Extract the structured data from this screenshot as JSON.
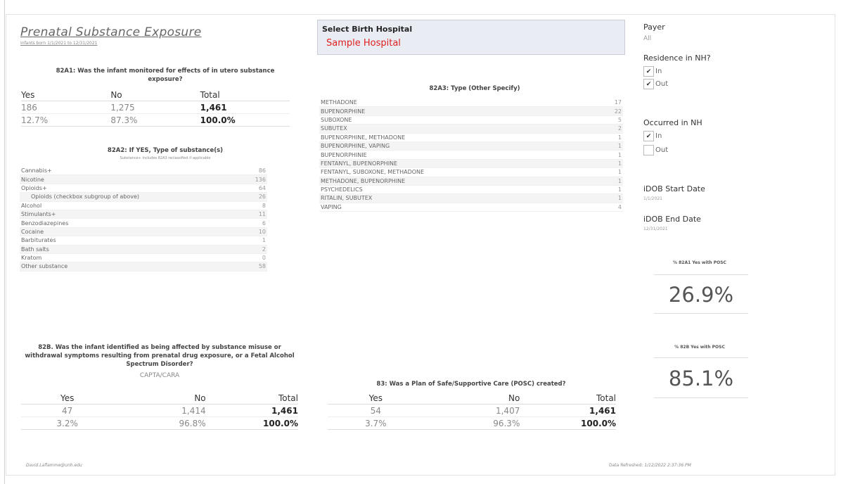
{
  "header": {
    "title": "Prenatal Substance Exposure",
    "subtitle": "Infants born 1/1/2021 to 12/31/2021"
  },
  "q82a1": {
    "question": "82A1: Was the infant monitored for effects of in utero substance exposure?",
    "headers": [
      "Yes",
      "No",
      "Total"
    ],
    "counts": [
      "186",
      "1,275",
      "1,461"
    ],
    "percents": [
      "12.7%",
      "87.3%",
      "100.0%"
    ]
  },
  "q82a2": {
    "question": "82A2: If YES, Type of substance(s)",
    "note": "Substance+ includes 82A3 reclassified if applicable",
    "rows": [
      {
        "label": "Cannabis+",
        "value": "86"
      },
      {
        "label": "Nicotine",
        "value": "136"
      },
      {
        "label": "Opioids+",
        "value": "64"
      },
      {
        "label": "Opioids (checkbox subgroup of above)",
        "value": "26"
      },
      {
        "label": "Alcohol",
        "value": "8"
      },
      {
        "label": "Stimulants+",
        "value": "11"
      },
      {
        "label": "Benzodiazepines",
        "value": "6"
      },
      {
        "label": "Cocaine",
        "value": "10"
      },
      {
        "label": "Barbiturates",
        "value": "1"
      },
      {
        "label": "Bath salts",
        "value": "2"
      },
      {
        "label": "Kratom",
        "value": "0"
      },
      {
        "label": "Other substance",
        "value": "58"
      }
    ]
  },
  "q82b": {
    "question": "82B. Was the infant identified as being affected by substance misuse or withdrawal symptoms resulting from prenatal drug exposure, or a Fetal Alcohol Spectrum Disorder?",
    "caption": "CAPTA/CARA",
    "headers": [
      "Yes",
      "No",
      "Total"
    ],
    "counts": [
      "47",
      "1,414",
      "1,461"
    ],
    "percents": [
      "3.2%",
      "96.8%",
      "100.0%"
    ]
  },
  "hospital": {
    "label": "Select Birth Hospital",
    "value": "Sample Hospital"
  },
  "q82a3": {
    "question": "82A3: Type (Other Specify)",
    "rows": [
      {
        "label": "METHADONE",
        "value": "17"
      },
      {
        "label": "BUPENORPHINE",
        "value": "22"
      },
      {
        "label": "SUBOXONE",
        "value": "5"
      },
      {
        "label": "SUBUTEX",
        "value": "2"
      },
      {
        "label": "BUPENORPHINE, METHADONE",
        "value": "1"
      },
      {
        "label": "BUPENORPHINE, VAPING",
        "value": "1"
      },
      {
        "label": "BUPENORPHINIE",
        "value": "1"
      },
      {
        "label": "FENTANYL, BUPENORPHINE",
        "value": "1"
      },
      {
        "label": "FENTANYL, SUBOXONE, METHADONE",
        "value": "1"
      },
      {
        "label": "METHADONE, BUPENORPHINE",
        "value": "1"
      },
      {
        "label": "PSYCHEDELICS",
        "value": "1"
      },
      {
        "label": "RITALIN, SUBUTEX",
        "value": "1"
      },
      {
        "label": "VAPING",
        "value": "4"
      }
    ]
  },
  "q83": {
    "question": "83: Was a Plan of Safe/Supportive Care (POSC) created?",
    "headers": [
      "Yes",
      "No",
      "Total"
    ],
    "counts": [
      "54",
      "1,407",
      "1,461"
    ],
    "percents": [
      "3.7%",
      "96.3%",
      "100.0%"
    ]
  },
  "filters": {
    "payer_label": "Payer",
    "payer_value": "All",
    "residence_label": "Residence in NH?",
    "residence_options": [
      {
        "label": "In",
        "checked": true
      },
      {
        "label": "Out",
        "checked": true
      }
    ],
    "occurred_label": "Occurred in NH",
    "occurred_options": [
      {
        "label": "In",
        "checked": true
      },
      {
        "label": "Out",
        "checked": false
      }
    ],
    "start_label": "iDOB Start Date",
    "start_value": "1/1/2021",
    "end_label": "iDOB End Date",
    "end_value": "12/31/2021"
  },
  "kpis": [
    {
      "title": "% 82A1 Yes with POSC",
      "value": "26.9%"
    },
    {
      "title": "% 82B Yes with POSC",
      "value": "85.1%"
    }
  ],
  "footer": {
    "author": "David.Laflamme@unh.edu",
    "refreshed_label": "Data Refreshed:",
    "refreshed_value": "1/12/2022 2:37:36 PM"
  },
  "icons": {
    "checked_glyph": "✔"
  }
}
